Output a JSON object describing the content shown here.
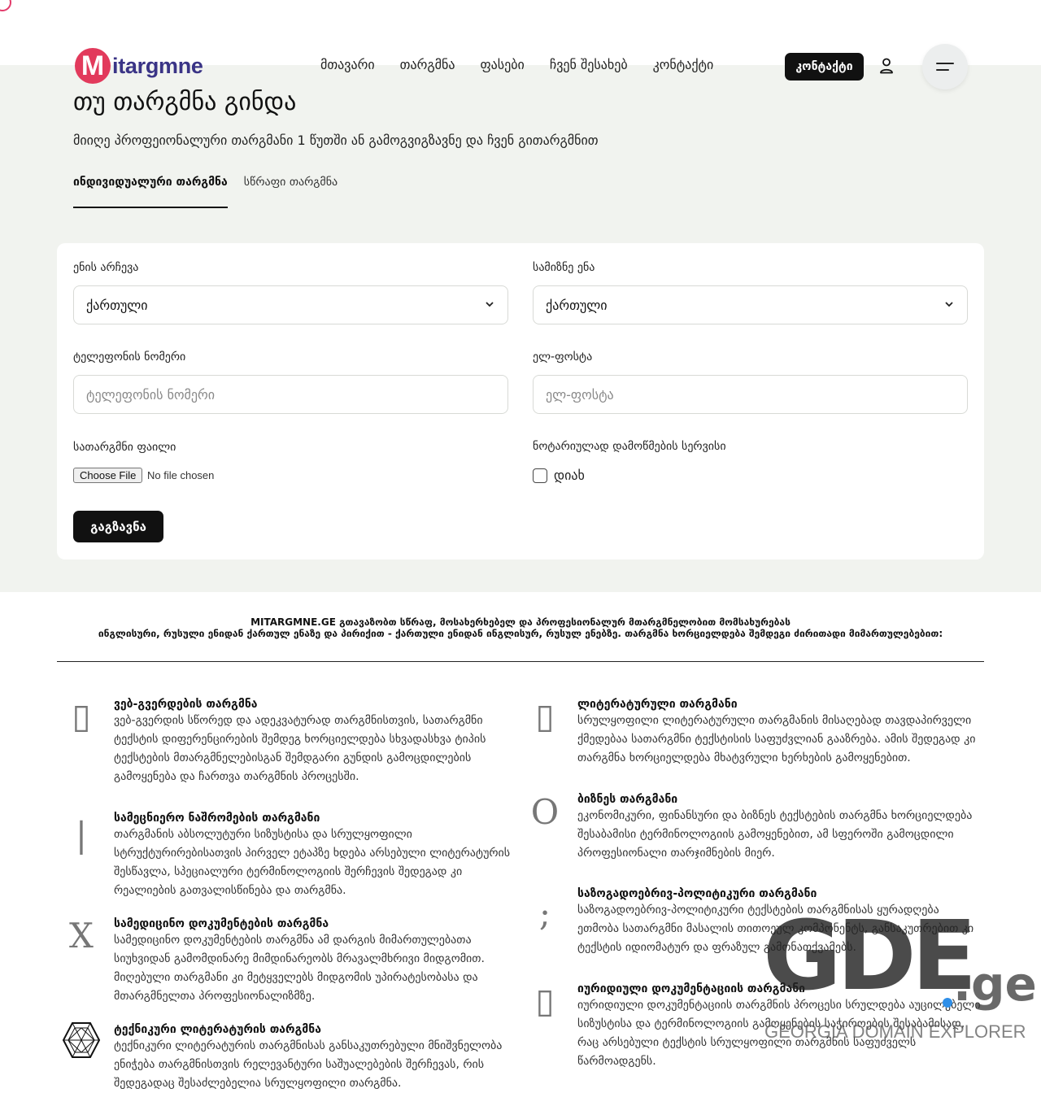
{
  "header": {
    "logo_letter": "M",
    "logo_text": "itargmne",
    "nav": [
      "მთავარი",
      "თარგმნა",
      "ფასები",
      "ჩვენ შესახებ",
      "კონტაქტი"
    ],
    "contact_button": "კონტაქტი"
  },
  "hero": {
    "title": "თუ თარგმნა გინდა",
    "subtitle": "მიიღე პროფეიონალური თარგმანი 1 წუთში ან გამოგვიგზავნე და ჩვენ გითარგმნით",
    "tabs": [
      "ინდივიდუალური თარგმნა",
      "სწრაფი თარგმნა"
    ],
    "active_tab": 0
  },
  "form": {
    "source_language": {
      "label": "ენის არჩევა",
      "value": "ქართული"
    },
    "target_language": {
      "label": "სამიზნე ენა",
      "value": "ქართული"
    },
    "phone": {
      "label": "ტელეფონის ნომერი",
      "placeholder": "ტელეფონის ნომერი"
    },
    "email": {
      "label": "ელ-ფოსტა",
      "placeholder": "ელ-ფოსტა"
    },
    "file": {
      "label": "სათარგმნი ფაილი",
      "button": "Choose File",
      "status": "No file chosen"
    },
    "notary": {
      "label": "ნოტარიულად დამოწმების სერვისი",
      "option": "დიახ",
      "checked": false
    },
    "submit": "გაგზავნა"
  },
  "intro": {
    "line1": "MITARGMNE.GE გთავაზობთ სწრაფ, მოსახერხებელ და პროფესიონალურ მთარგმნელობით მომსახურებას",
    "line2": "ინგლისური, რუსული ენიდან ქართულ ენაზე და პირიქით - ქართული ენიდან ინგლისურ, რუსულ ენებზე. თარგმნა ხორციელდება შემდეგი ძირითადი მიმართულებებით:"
  },
  "services": [
    {
      "icon": "missing-glyph-icon",
      "glyph": "▯",
      "title": "ვებ-გვერდების თარგმნა",
      "description": "ვებ-გვერდის სწორედ და ადეკვატურად თარგმნისთვის, სათარგმნი ტექსტის დიფერენცირების შემდეგ ხორციელდება სხვადასხვა ტიპის ტექსტების მთარგმნელებისგან შემდგარი გუნდის გამოცდილების გამოყენება და ჩართვა თარგმნის პროცესში."
    },
    {
      "icon": "missing-glyph-icon",
      "glyph": "▯",
      "title": "ლიტერატურული თარგმანი",
      "description": "სრულყოფილი ლიტერატურული თარგმანის მისაღებად თავდაპირველი ქმედებაა სათარგმნი ტექსტისის საფუძვლიან გააზრება. ამის შედეგად კი თარგმნა ხორციელდება მხატვრული ხერხების გამოყენებით."
    },
    {
      "icon": "vertical-bar-icon",
      "glyph": "|",
      "title": "სამეცნიერო ნაშრომების თარგმანი",
      "description": "თარგმანის აბსოლუტური სიზუსტისა და სრულყოფილი სტრუქტურირებისათვის პირველ ეტაპზე ხდება არსებული ლიტერატურის შესწავლა, სპეციალური ტერმინოლოგიის შერჩევის შედეგად კი რეალიების გათვალისწინება და თარგმნა."
    },
    {
      "icon": "circle-o-icon",
      "glyph": "O",
      "title": "ბიზნეს თარგმანი",
      "description": "ეკონომიკური, ფინანსური და ბიზნეს ტექსტების თარგმნა ხორციელდება შესაბამისი ტერმინოლოგიის გამოყენებით, ამ სფეროში გამოცდილი პროფესიონალი თარჯიმნების მიერ."
    },
    {
      "icon": "x-glyph-icon",
      "glyph": "X",
      "title": "სამედიცინო დოკუმენტების თარგმნა",
      "description": "სამედიცინო დოკუმენტების თარგმნა ამ დარგის მიმართულებათა სიუხვიდან გამომდინარე მიმდინარეობს მრავალმხრივი მიდგომით. მიღებული თარგმანი კი მეტყველებს მიდგომის უპირატესობასა და მთარგმნელთა პროფესიონალიზმზე."
    },
    {
      "icon": "semicolon-icon",
      "glyph": ";",
      "title": "საზოგადოებრივ-პოლიტიკური თარგმანი",
      "description": "საზოგადოებრივ-პოლიტიკური ტექსტების თარგმნისას ყურადღება ეთმობა სათარგმნი მასალის თითოეულ კომპონენტს, განსაკუთრებით კი ტექსტის იდიომატურ და ფრაზულ გამონათქვამებს."
    },
    {
      "icon": "hexagon-web-icon",
      "glyph": "",
      "title": "ტექნიკური ლიტერატურის თარგმნა",
      "description": "ტექნიკური ლიტერატურის თარგმნისას განსაკუთრებული მნიშვნელობა ენიჭება თარგმნისთვის რელევანტური საშუალებების შერჩევას, რის შედეგადაც შესაძლებელია სრულყოფილი თარგმნა."
    },
    {
      "icon": "missing-glyph-icon",
      "glyph": "▯",
      "title": "იურიდიული დოკუმენტაციის თარგმანი",
      "description": "იურიდიული დოკუმენტაციის თარგმნის პროცესი სრულდება აუცილებელი სიზუსტისა და ტერმინოლოგიის გამოყენების საჭიროების შესაბამისად, რაც არსებული ტექსტის სრულყოფილი თარგმნის საფუძველს წარმოადგენს."
    }
  ],
  "watermark": {
    "big": "GDE",
    "suffix": ".ge",
    "subtitle": "GEORGIA DOMAIN EXPLORER"
  },
  "colors": {
    "brand_red": "#e23a5c",
    "brand_navy": "#3a3486",
    "hero_bg": "#f1f3ef",
    "dark": "#111111"
  }
}
